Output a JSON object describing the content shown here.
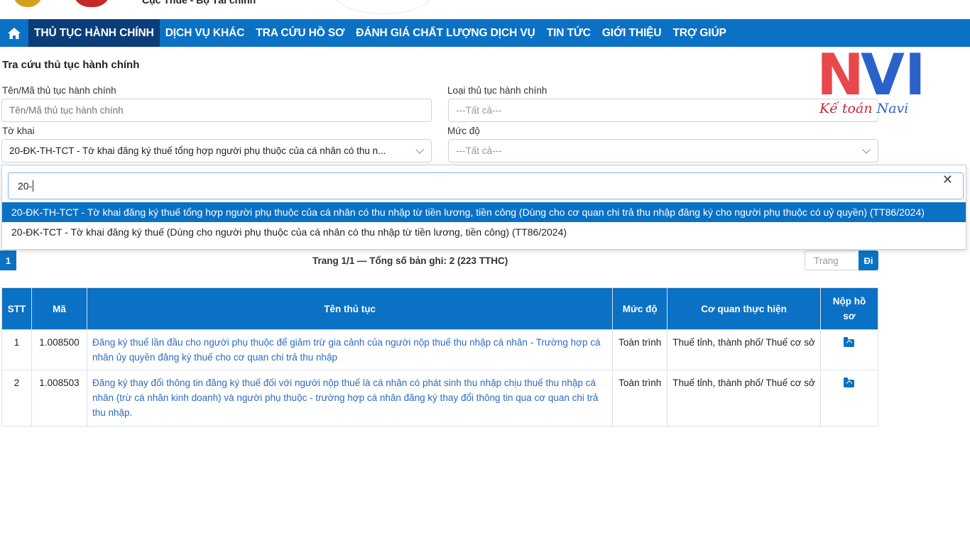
{
  "header": {
    "org_name": "Cục Thuế - Bộ Tài chính"
  },
  "nav": {
    "home_icon": "home-icon",
    "items": [
      {
        "label": "THỦ TỤC HÀNH CHÍNH",
        "active": true
      },
      {
        "label": "DỊCH VỤ KHÁC"
      },
      {
        "label": "TRA CỨU HỒ SƠ"
      },
      {
        "label": "ĐÁNH GIÁ CHẤT LƯỢNG DỊCH VỤ"
      },
      {
        "label": "TIN TỨC"
      },
      {
        "label": "GIỚI THIỆU"
      },
      {
        "label": "TRỢ GIÚP"
      }
    ]
  },
  "form": {
    "title": "Tra cứu thủ tục hành chính",
    "name_label": "Tên/Mã thủ tục hành chính",
    "name_placeholder": "Tên/Mã thủ tục hành chính",
    "type_label": "Loại thủ tục hành chính",
    "type_value": "---Tất cả---",
    "form_label": "Tờ khai",
    "form_value": "20-ĐK-TH-TCT - Tờ khai đăng ký thuế tổng hợp người phụ thuộc của cá nhân có thu n...",
    "level_label": "Mức độ",
    "level_value": "---Tất cả---"
  },
  "dropdown": {
    "search_value": "20-",
    "clear_icon": "close-icon",
    "options": [
      {
        "label": "20-ĐK-TH-TCT - Tờ khai đăng ký thuế tổng hợp người phụ thuộc của cá nhân có thu nhập từ tiền lương, tiền công (Dùng cho cơ quan chi trả thu nhập đăng ký cho người phụ thuộc có uỷ quyền) (TT86/2024)",
        "selected": true
      },
      {
        "label": "20-ĐK-TCT - Tờ khai đăng ký thuế (Dùng cho người phụ thuộc của cá nhân có thu nhập từ tiền lương, tiền công) (TT86/2024)",
        "selected": false
      }
    ]
  },
  "pagination": {
    "current_page": "1",
    "info": "Trang 1/1 — Tổng số bản ghi: 2 (223 TTHC)",
    "page_placeholder": "Trang",
    "go_label": "Đi"
  },
  "table": {
    "headers": [
      "STT",
      "Mã",
      "Tên thủ tục",
      "Mức độ",
      "Cơ quan thực hiện",
      "Nộp hồ sơ"
    ],
    "rows": [
      {
        "stt": "1",
        "code": "1.008500",
        "name": "Đăng ký thuế lần đầu cho người phụ thuộc để giảm trừ gia cảnh của người nộp thuế thu nhập cá nhân - Trường hợp cá nhân ủy quyền đăng ký thuế cho cơ quan chi trả thu nhập",
        "level": "Toàn trình",
        "agency": "Thuế tỉnh, thành phố/ Thuế cơ sở",
        "submit_icon": "upload-folder-icon"
      },
      {
        "stt": "2",
        "code": "1.008503",
        "name": "Đăng ký thay đổi thông tin đăng ký thuế đối với người nộp thuế là cá nhân có phát sinh thu nhập chịu thuế thu nhập cá nhân (trừ cá nhân kinh doanh) và người phụ thuộc - trường hợp cá nhân đăng ký thay đổi thông tin qua cơ quan chi trả thu nhập.",
        "level": "Toàn trình",
        "agency": "Thuế tỉnh, thành phố/ Thuế cơ sở",
        "submit_icon": "upload-folder-icon"
      }
    ]
  },
  "watermark": {
    "letters_n": "N",
    "letters_v": "VI",
    "sub_a": "Kế toán ",
    "sub_b": "Navi"
  },
  "colors": {
    "primary": "#0b71c5",
    "nav_active": "#0a3d7a",
    "link": "#2a6cc4"
  }
}
